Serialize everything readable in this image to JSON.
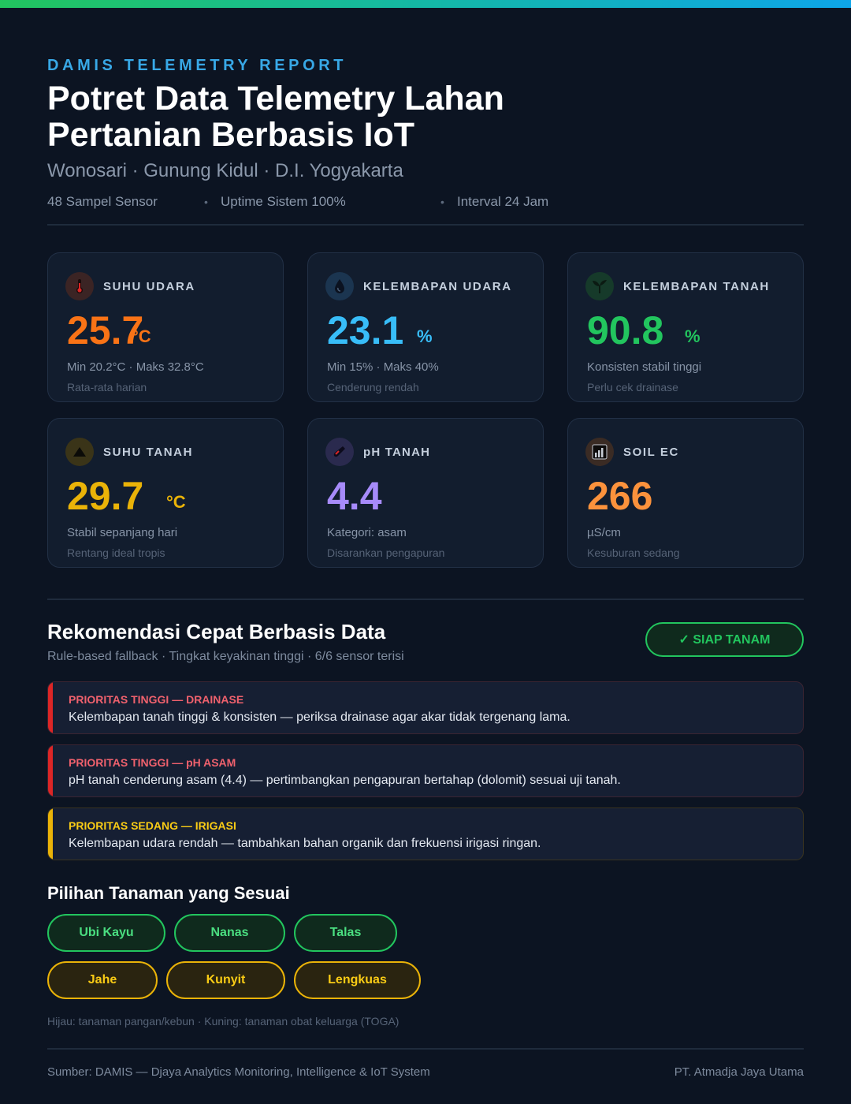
{
  "header": {
    "eyebrow": "DAMIS TELEMETRY REPORT",
    "title": "Potret Data Telemetry Lahan Pertanian Berbasis IoT",
    "subtitle": "Wonosari · Gunung Kidul · D.I. Yogyakarta",
    "meta": [
      "48 Sampel Sensor",
      "Uptime Sistem 100%",
      "Interval 24 Jam"
    ],
    "meta_separator": "•"
  },
  "metrics": [
    {
      "label": "SUHU UDARA",
      "value": "25.7",
      "unit": "°C",
      "line1": "Min 20.2°C · Maks 32.8°C",
      "line2": "Rata-rata harian",
      "color": "#f97316",
      "icon": "thermometer-icon"
    },
    {
      "label": "KELEMBAPAN UDARA",
      "value": "23.1",
      "unit": "%",
      "line1": "Min 15% · Maks 40%",
      "line2": "Cenderung rendah",
      "color": "#38bdf8",
      "icon": "water-drop-icon"
    },
    {
      "label": "KELEMBAPAN TANAH",
      "value": "90.8",
      "unit": "%",
      "line1": "Konsisten stabil tinggi",
      "line2": "Perlu cek drainase",
      "color": "#22c55e",
      "icon": "seedling-icon"
    },
    {
      "label": "SUHU TANAH",
      "value": "29.7",
      "unit": "°C",
      "line1": "Stabil sepanjang hari",
      "line2": "Rentang ideal tropis",
      "color": "#eab308",
      "icon": "mountain-icon"
    },
    {
      "label": "pH TANAH",
      "value": "4.4",
      "unit": "",
      "line1": "Kategori: asam",
      "line2": "Disarankan pengapuran",
      "color": "#a78bfa",
      "icon": "test-tube-icon"
    },
    {
      "label": "SOIL EC",
      "value": "266",
      "unit": "",
      "line1": "µS/cm",
      "line2": "Kesuburan sedang",
      "color": "#fb923c",
      "icon": "bar-chart-icon"
    }
  ],
  "recommendations": {
    "title": "Rekomendasi Cepat Berbasis Data",
    "subtitle": "Rule-based fallback · Tingkat keyakinan tinggi · 6/6 sensor terisi",
    "status_badge": "✓ SIAP TANAM",
    "items": [
      {
        "title": "PRIORITAS TINGGI — DRAINASE",
        "text": "Kelembapan tanah tinggi & konsisten — periksa drainase agar akar tidak tergenang lama.",
        "color": "#dc2626",
        "title_color": "#f0616d"
      },
      {
        "title": "PRIORITAS TINGGI — pH ASAM",
        "text": "pH tanah cenderung asam (4.4) — pertimbangkan pengapuran bertahap (dolomit) sesuai uji tanah.",
        "color": "#dc2626",
        "title_color": "#f0616d"
      },
      {
        "title": "PRIORITAS SEDANG — IRIGASI",
        "text": "Kelembapan udara rendah — tambahkan bahan organik dan frekuensi irigasi ringan.",
        "color": "#eab308",
        "title_color": "#facc15"
      }
    ]
  },
  "crops": {
    "title": "Pilihan Tanaman yang Sesuai",
    "green": [
      "Ubi Kayu",
      "Nanas",
      "Talas"
    ],
    "yellow": [
      "Jahe",
      "Kunyit",
      "Lengkuas"
    ],
    "legend": "Hijau: tanaman pangan/kebun · Kuning: tanaman obat keluarga (TOGA)"
  },
  "footer": {
    "source": "Sumber: DAMIS — Djaya Analytics Monitoring, Intelligence & IoT System",
    "company": "PT. Atmadja Jaya Utama"
  }
}
